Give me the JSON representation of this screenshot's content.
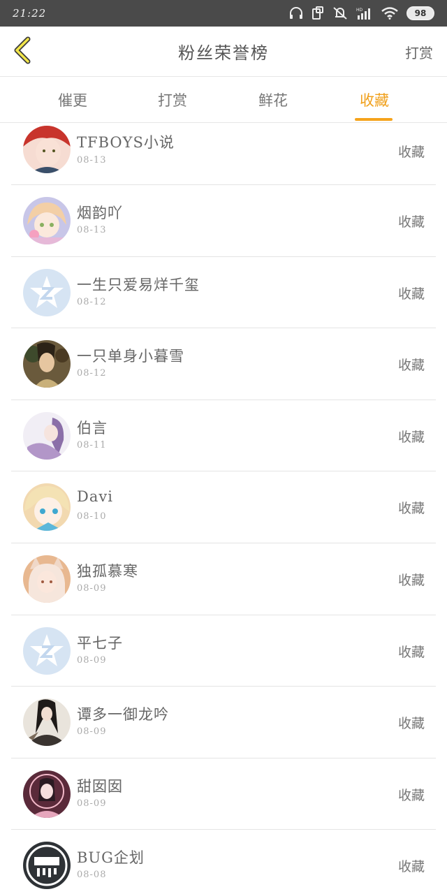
{
  "status_bar": {
    "time": "21:22",
    "battery": "98"
  },
  "header": {
    "title": "粉丝荣誉榜",
    "action": "打赏"
  },
  "tabs": [
    {
      "label": "催更",
      "active": false
    },
    {
      "label": "打赏",
      "active": false
    },
    {
      "label": "鲜花",
      "active": false
    },
    {
      "label": "收藏",
      "active": true
    }
  ],
  "colors": {
    "accent": "#f5a31c",
    "status_bar": "#4a4a4a",
    "divider": "#e4e4e4"
  },
  "fans": [
    {
      "name": "TFBOYS小说",
      "date": "08-13",
      "action": "收藏",
      "avatar": "red-hair-avatar"
    },
    {
      "name": "烟韵吖",
      "date": "08-13",
      "action": "收藏",
      "avatar": "pink-girl-avatar"
    },
    {
      "name": "一生只爱易烊千玺",
      "date": "08-12",
      "action": "收藏",
      "avatar": "default-star-avatar"
    },
    {
      "name": "一只单身小暮雪",
      "date": "08-12",
      "action": "收藏",
      "avatar": "warrior-avatar"
    },
    {
      "name": "伯言",
      "date": "08-11",
      "action": "收藏",
      "avatar": "purple-girl-avatar"
    },
    {
      "name": "Davi",
      "date": "08-10",
      "action": "收藏",
      "avatar": "blonde-girl-avatar"
    },
    {
      "name": "独孤慕寒",
      "date": "08-09",
      "action": "收藏",
      "avatar": "fox-girl-avatar"
    },
    {
      "name": "平七子",
      "date": "08-09",
      "action": "收藏",
      "avatar": "default-star-avatar"
    },
    {
      "name": "谭多一御龙吟",
      "date": "08-09",
      "action": "收藏",
      "avatar": "dark-hair-avatar"
    },
    {
      "name": "甜囡囡",
      "date": "08-09",
      "action": "收藏",
      "avatar": "music-girl-avatar"
    },
    {
      "name": "BUG企划",
      "date": "08-08",
      "action": "收藏",
      "avatar": "bug-logo-avatar"
    }
  ]
}
